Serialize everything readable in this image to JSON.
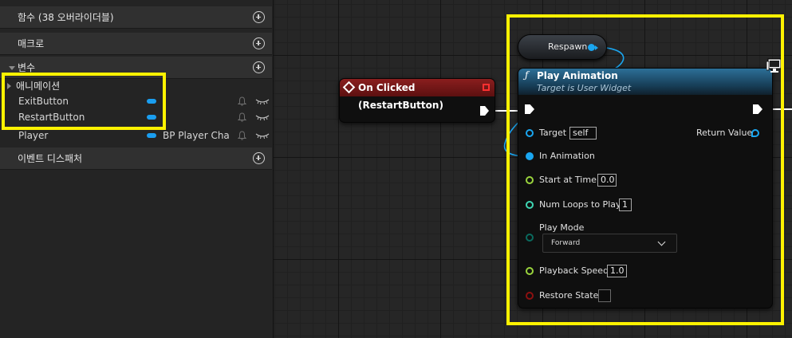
{
  "sidebar": {
    "functions_label": "함수 (38 오버라이더블)",
    "macros_label": "매크로",
    "variables_label": "변수",
    "category_label": "애니메이션",
    "variables": [
      {
        "name": "ExitButton",
        "type": ""
      },
      {
        "name": "RestartButton",
        "type": ""
      },
      {
        "name": "Player",
        "type": "BP Player Character"
      }
    ],
    "dispatchers_label": "이벤트 디스패처"
  },
  "graph": {
    "event_node": {
      "title": "On Clicked (RestartButton)"
    },
    "respawn_node": {
      "label": "Respawn"
    },
    "play_animation_node": {
      "title": "Play Animation",
      "subtitle": "Target is User Widget",
      "inputs": {
        "target_label": "Target",
        "target_value": "self",
        "in_animation_label": "In Animation",
        "start_at_time_label": "Start at Time",
        "start_at_time_value": "0.0",
        "num_loops_label": "Num Loops to Play",
        "num_loops_value": "1",
        "play_mode_label": "Play Mode",
        "play_mode_value": "Forward",
        "playback_speed_label": "Playback Speed",
        "playback_speed_value": "1.0",
        "restore_state_label": "Restore State"
      },
      "outputs": {
        "return_value_label": "Return Value"
      }
    }
  },
  "colors": {
    "highlight": "#fff200",
    "object_pin": "#1aa6f0",
    "float_pin": "#9ad43d",
    "int_pin": "#3fd6b3",
    "enum_pin": "#0a6a5e",
    "bool_pin": "#8c1010",
    "event_header": "#8a1e1e",
    "function_header": "#2c6f97"
  },
  "icons": [
    "add-circle-icon",
    "expand-caret-icon",
    "bell-icon",
    "eye-icon",
    "event-diamond-icon",
    "stop-icon",
    "function-f-icon",
    "monitor-icon",
    "chevron-down-icon"
  ]
}
